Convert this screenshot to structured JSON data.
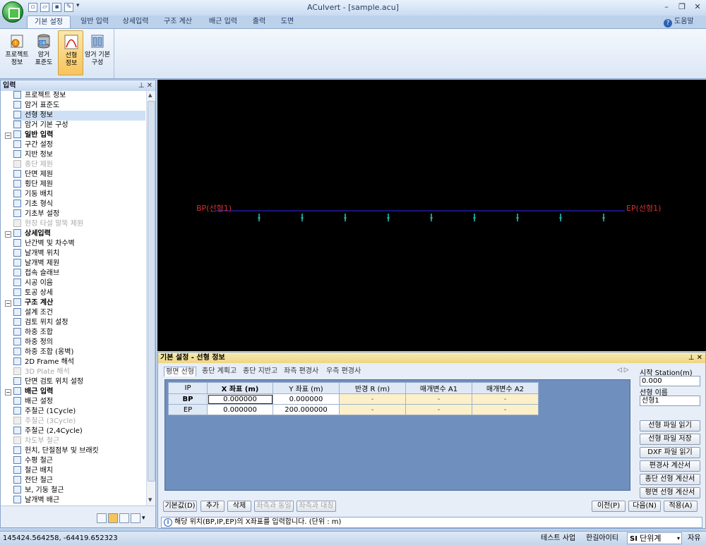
{
  "window": {
    "title": "ACulvert - [sample.acu]",
    "minimize": "–",
    "restore": "❐",
    "close": "✕"
  },
  "ribbon": {
    "tabs": [
      "기본 설정",
      "일반 입력",
      "상세입력",
      "구조 계산",
      "배근 입력",
      "출력",
      "도면"
    ],
    "active_tab": "기본 설정",
    "help": "도움말",
    "buttons": [
      {
        "label": "프로젝트\n정보",
        "icon": "project-info-icon"
      },
      {
        "label": "암거\n표준도",
        "icon": "standard-drawing-icon"
      },
      {
        "label": "선형\n정보",
        "icon": "alignment-info-icon"
      },
      {
        "label": "암거 기본\n구성",
        "icon": "basic-layout-icon"
      }
    ]
  },
  "left_panel": {
    "title": "입력",
    "pins": "⊥ ✕",
    "tree": [
      {
        "label": "프로젝트 정보",
        "level": 1
      },
      {
        "label": "암거 표준도",
        "level": 1
      },
      {
        "label": "선형 정보",
        "level": 1,
        "selected": true
      },
      {
        "label": "암거 기본 구성",
        "level": 1
      },
      {
        "label": "일반 입력",
        "level": 0
      },
      {
        "label": "구간 설정",
        "level": 1
      },
      {
        "label": "지반 정보",
        "level": 1
      },
      {
        "label": "종단 제원",
        "level": 1,
        "disabled": true
      },
      {
        "label": "단면 제원",
        "level": 1
      },
      {
        "label": "횡단 제원",
        "level": 1
      },
      {
        "label": "기둥 배치",
        "level": 1
      },
      {
        "label": "기초 형식",
        "level": 1
      },
      {
        "label": "기초부 설정",
        "level": 1
      },
      {
        "label": "현장 타설 말뚝 제원",
        "level": 1,
        "disabled": true
      },
      {
        "label": "상세입력",
        "level": 0
      },
      {
        "label": "난간벽 및 차수벽",
        "level": 1
      },
      {
        "label": "날개벽 위치",
        "level": 1
      },
      {
        "label": "날개벽 제원",
        "level": 1
      },
      {
        "label": "접속 슬래브",
        "level": 1
      },
      {
        "label": "시공 이음",
        "level": 1
      },
      {
        "label": "토공 상세",
        "level": 1
      },
      {
        "label": "구조 계산",
        "level": 0
      },
      {
        "label": "설계 조건",
        "level": 1
      },
      {
        "label": "검토 위치 설정",
        "level": 1
      },
      {
        "label": "하중 조합",
        "level": 1
      },
      {
        "label": "하중 정의",
        "level": 1
      },
      {
        "label": "하중 조합 (옹벽)",
        "level": 1
      },
      {
        "label": "2D Frame 해석",
        "level": 1
      },
      {
        "label": "3D Plate 해석",
        "level": 1,
        "disabled": true
      },
      {
        "label": "단면 검토 위치 설정",
        "level": 1
      },
      {
        "label": "배근 입력",
        "level": 0
      },
      {
        "label": "배근 설정",
        "level": 1
      },
      {
        "label": "주철근 (1Cycle)",
        "level": 1
      },
      {
        "label": "주철근 (3Cycle)",
        "level": 1,
        "disabled": true
      },
      {
        "label": "주철근 (2,4Cycle)",
        "level": 1
      },
      {
        "label": "차도부 철근",
        "level": 1,
        "disabled": true
      },
      {
        "label": "헌치, 단절점부 및 브래킷",
        "level": 1
      },
      {
        "label": "수평 철근",
        "level": 1
      },
      {
        "label": "철근 배치",
        "level": 1
      },
      {
        "label": "전단 철근",
        "level": 1
      },
      {
        "label": "보, 기둥 철근",
        "level": 1
      },
      {
        "label": "날개벽 배근",
        "level": 1
      }
    ]
  },
  "canvas": {
    "bp_label": "BP(선형1)",
    "ep_label": "EP(선형1)",
    "line_color": "#2d2dff",
    "label_color": "#d43030",
    "marker_color": "#27c9c9",
    "marker_count": 9
  },
  "bottom_panel": {
    "title": "기본 설정 - 선형 정보",
    "pins": "⊥ ✕",
    "subtabs": [
      "평면 선형",
      "종단 계획고",
      "종단 지반고",
      "좌측 편경사",
      "우측 편경사"
    ],
    "active_subtab": "평면 선형",
    "tab_nav": "◁ ▷",
    "grid": {
      "columns": [
        "IP",
        "X 좌표 (m)",
        "Y 좌표 (m)",
        "반경 R (m)",
        "매개변수 A1",
        "매개변수 A2"
      ],
      "rows": [
        [
          "BP",
          "0.000000",
          "0.000000",
          "-",
          "-",
          "-"
        ],
        [
          "EP",
          "0.000000",
          "200.000000",
          "-",
          "-",
          "-"
        ]
      ]
    },
    "start_station_label": "시작 Station(m)",
    "start_station_value": "0.000",
    "alignment_name_label": "선형 이름",
    "alignment_name_value": "선형1",
    "side_buttons": [
      "선형 파일 읽기",
      "선형 파일 저장",
      "DXF 파일 읽기",
      "편경사 계산서",
      "종단 선형 계산서",
      "평면 선형 계산서"
    ],
    "bottom_buttons": [
      {
        "label": "기본값(D)",
        "disabled": false
      },
      {
        "label": "추가",
        "disabled": false
      },
      {
        "label": "삭제",
        "disabled": false
      },
      {
        "label": "좌측과 동일",
        "disabled": true
      },
      {
        "label": "좌측과 대칭",
        "disabled": true
      }
    ],
    "nav_buttons": [
      "이전(P)",
      "다음(N)",
      "적용(A)"
    ],
    "message": "해당 위치(BP,IP,EP)의 X좌표를 입력합니다. (단위 : m)"
  },
  "status_bar": {
    "coordinates": "145424.564258,  -64419.652323",
    "items": [
      "테스트 사업",
      "한길아이티"
    ],
    "unit_prefix": "SI",
    "unit_label": "단위계",
    "mode": "자유"
  }
}
